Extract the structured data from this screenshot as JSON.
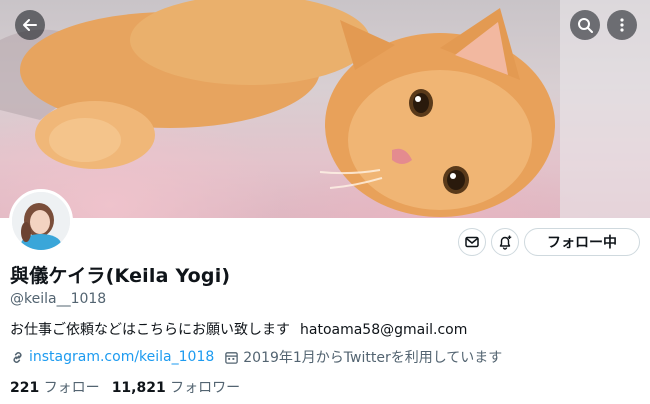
{
  "header": {
    "back_icon": "arrow-left-icon",
    "search_icon": "search-icon",
    "more_icon": "more-vertical-icon"
  },
  "profile": {
    "display_name": "與儀ケイラ(Keila Yogi)",
    "handle": "@keila__1018",
    "bio_text": "お仕事ご依頼などはこちらにお願い致します",
    "bio_email": "hatoama58@gmail.com",
    "link": "instagram.com/keila_1018",
    "joined": "2019年1月からTwitterを利用しています",
    "following_count": "221",
    "following_label": "フォロー",
    "followers_count": "11,821",
    "followers_label": "フォロワー"
  },
  "actions": {
    "follow_button": "フォロー中",
    "mail_icon": "mail-icon",
    "notify_icon": "bell-plus-icon"
  },
  "colors": {
    "accent": "#1d9bf0",
    "muted_text": "#536471",
    "primary_text": "#0f1419"
  }
}
